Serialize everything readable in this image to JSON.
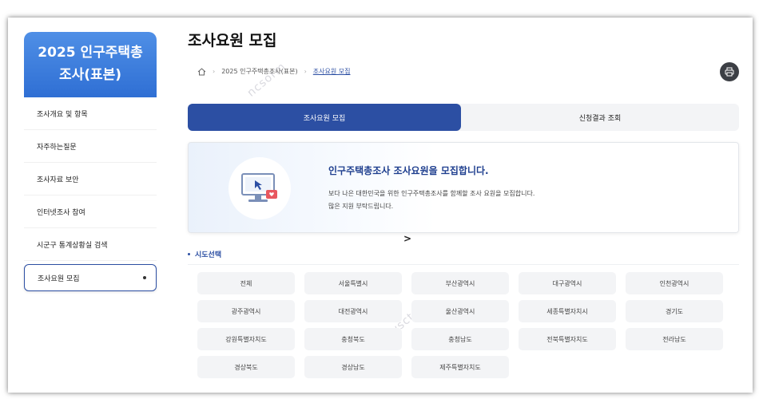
{
  "sidebar": {
    "title_line1": "2025 인구주택총",
    "title_line2": "조사(표본)",
    "items": [
      {
        "label": "조사개요 및 항목"
      },
      {
        "label": "자주하는질문"
      },
      {
        "label": "조사자료 보안"
      },
      {
        "label": "인터넷조사 참여"
      },
      {
        "label": "시군구 통계상황실 검색"
      },
      {
        "label": "조사요원 모집"
      }
    ]
  },
  "page": {
    "title": "조사요원 모집"
  },
  "breadcrumb": {
    "items": [
      "2025 인구주택총조사(표본)",
      "조사요원 모집"
    ]
  },
  "tabs": [
    {
      "label": "조사요원 모집",
      "active": true
    },
    {
      "label": "신청결과 조회",
      "active": false
    }
  ],
  "banner": {
    "title": "인구주택총조사 조사요원을 모집합니다.",
    "line1": "보다 나은 대한민국을 위한 인구주택총조사를 함께할 조사 요원을 모집합니다.",
    "line2": "많은 지원 부탁드립니다."
  },
  "cursor_glyph": ">",
  "region_section": {
    "label": "시도선택",
    "regions": [
      "전체",
      "서울특별시",
      "부산광역시",
      "대구광역시",
      "인천광역시",
      "광주광역시",
      "대전광역시",
      "울산광역시",
      "세종특별자치시",
      "경기도",
      "강원특별자치도",
      "충청북도",
      "충청남도",
      "전북특별자치도",
      "전라남도",
      "경상북도",
      "경상남도",
      "제주특별자치도"
    ]
  },
  "colors": {
    "accent": "#2c4fa3",
    "sidebar_gradient_top": "#4f8fe6",
    "sidebar_gradient_bottom": "#2f6fd4"
  },
  "icons": {
    "home": "home-icon",
    "print": "print-icon",
    "monitor": "monitor-illustration-icon"
  }
}
